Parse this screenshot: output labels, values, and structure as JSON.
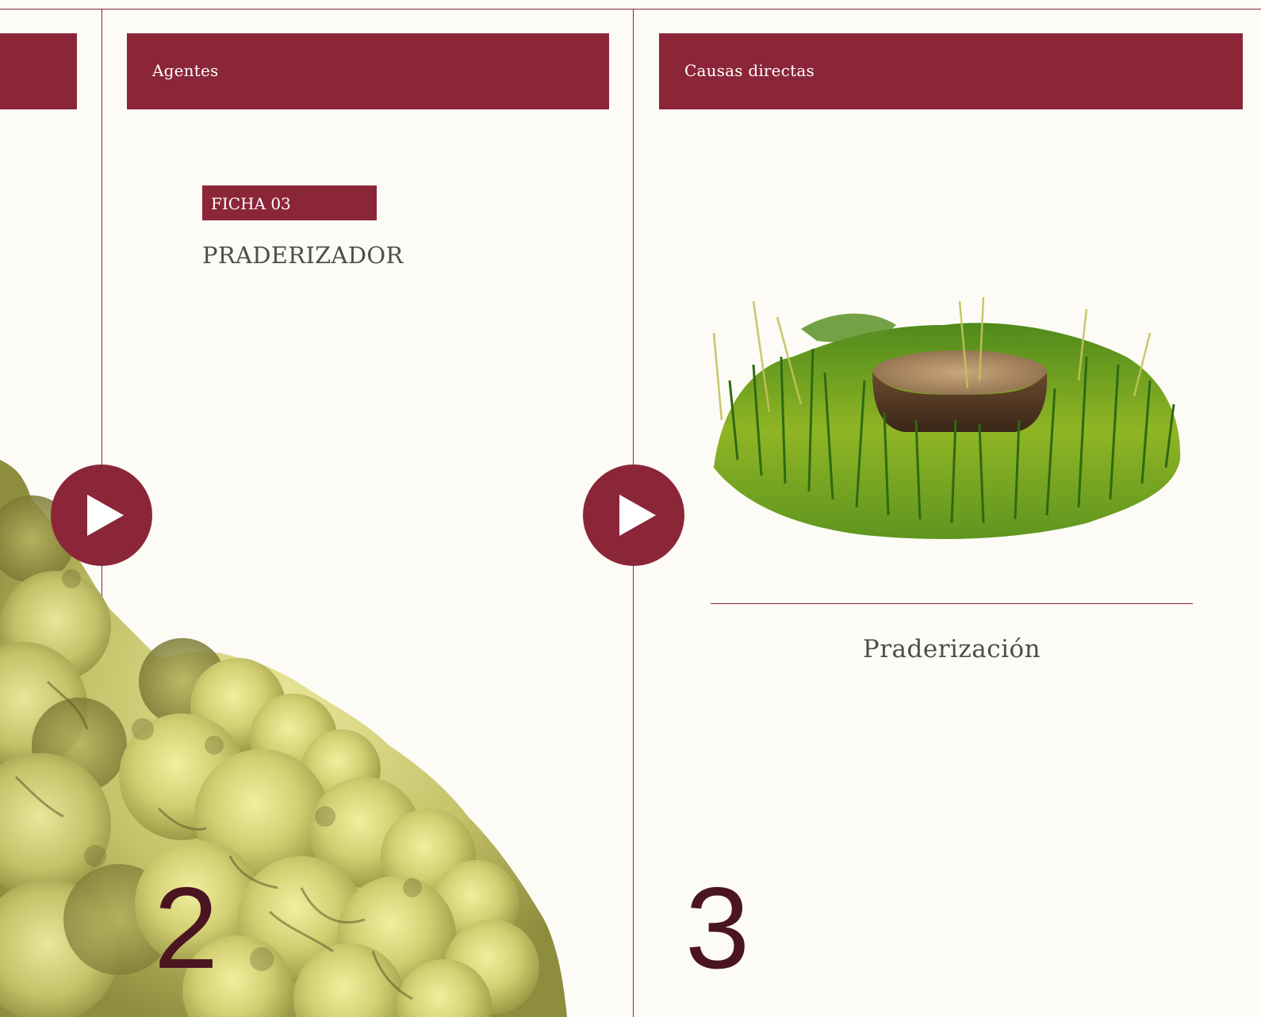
{
  "panels": {
    "left": {
      "header_label": "Agentes",
      "ficha_label": "FICHA 03",
      "ficha_title": "PRADERIZADOR",
      "page_number": "2"
    },
    "right": {
      "header_label": "Causas directas",
      "caption": "Praderización",
      "page_number": "3"
    }
  },
  "controls": {
    "play_buttons": [
      "play-icon",
      "play-icon"
    ]
  },
  "colors": {
    "accent": "#8b2639",
    "background": "#fdfbf5",
    "page_number": "#4a1520",
    "text": "#4d4d4d"
  }
}
